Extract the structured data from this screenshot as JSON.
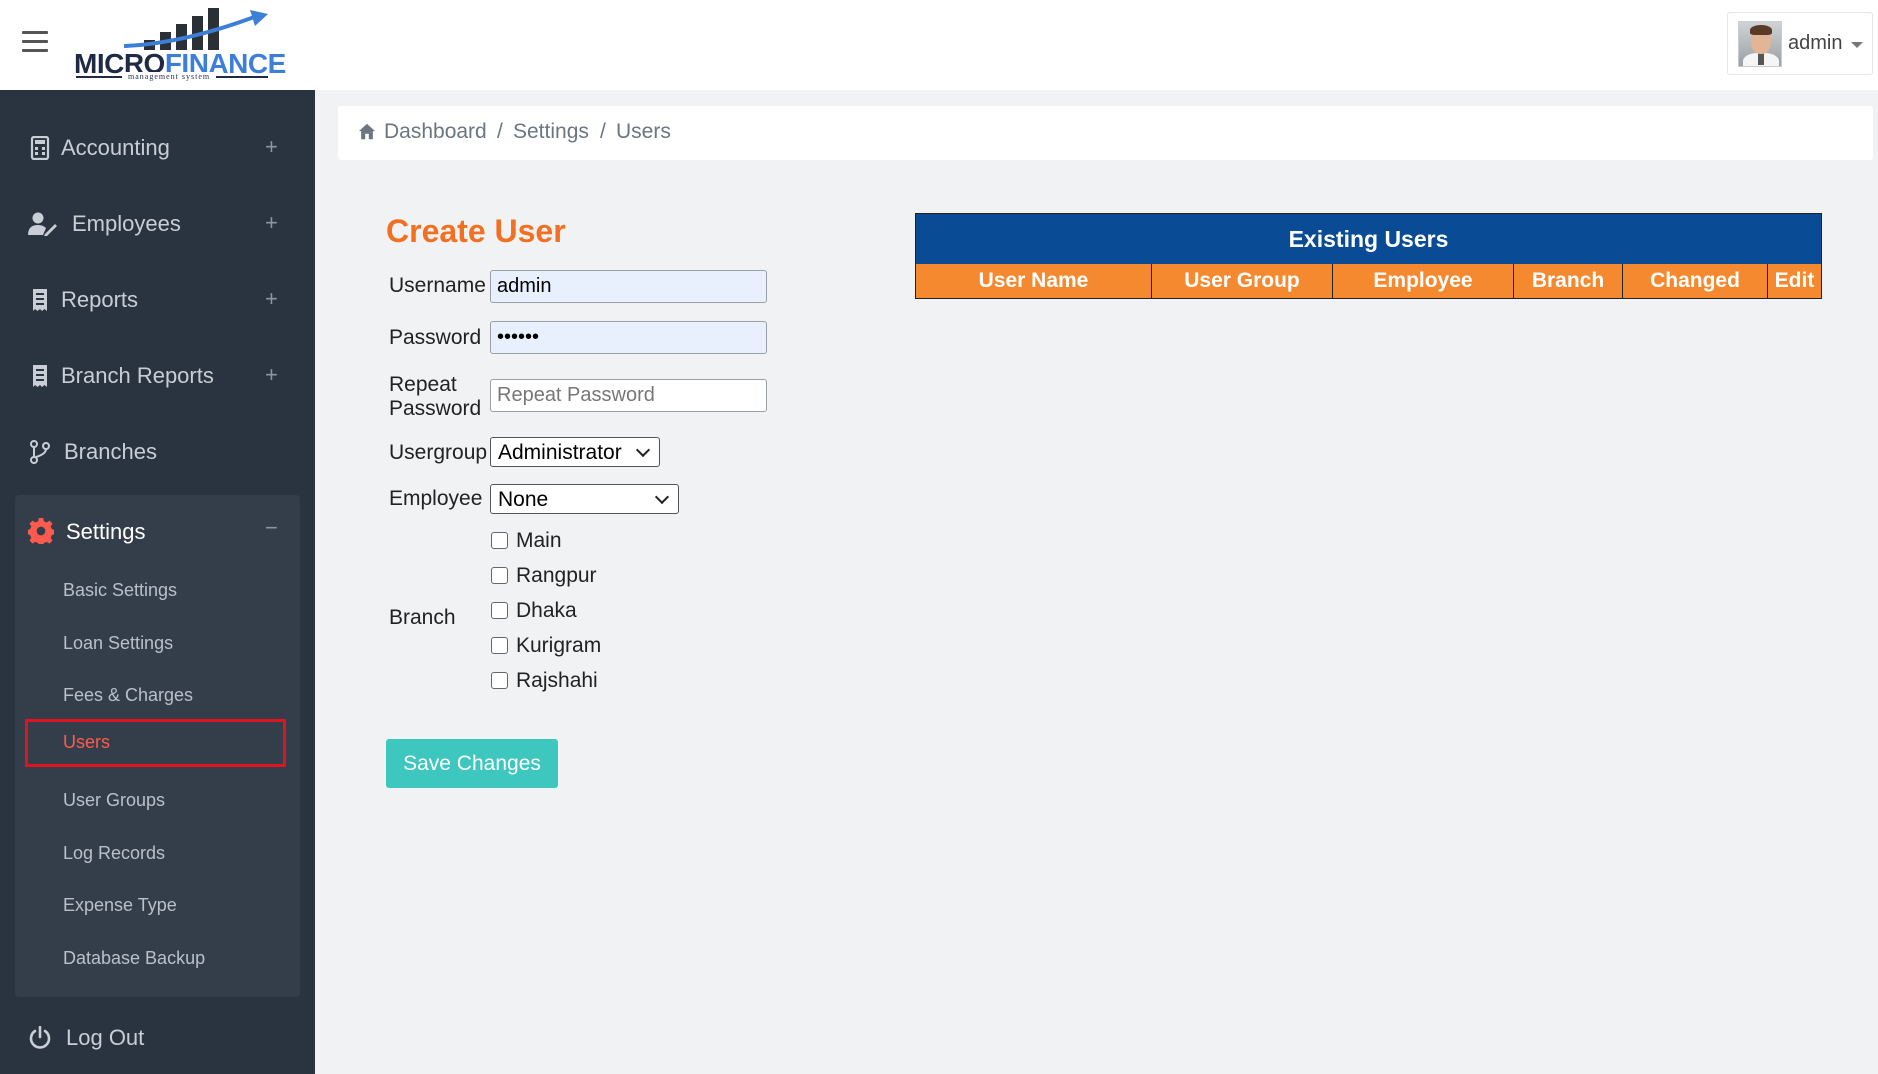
{
  "header": {
    "logo": {
      "brand_part1": "MICRO",
      "brand_part2": "FINANCE",
      "tagline": "management system"
    },
    "user": {
      "name": "admin"
    }
  },
  "sidebar": {
    "items": [
      {
        "label": "Accounting",
        "icon": "calculator-icon",
        "expand": "+"
      },
      {
        "label": "Employees",
        "icon": "user-edit-icon",
        "expand": "+"
      },
      {
        "label": "Reports",
        "icon": "receipt-icon",
        "expand": "+"
      },
      {
        "label": "Branch Reports",
        "icon": "receipt-icon",
        "expand": "+"
      },
      {
        "label": "Branches",
        "icon": "branch-icon"
      }
    ],
    "settings": {
      "label": "Settings",
      "icon": "gear-icon",
      "collapse": "−",
      "subitems": [
        {
          "label": "Basic Settings"
        },
        {
          "label": "Loan Settings"
        },
        {
          "label": "Fees & Charges"
        },
        {
          "label": "Users",
          "active": true
        },
        {
          "label": "User Groups"
        },
        {
          "label": "Log Records"
        },
        {
          "label": "Expense Type"
        },
        {
          "label": "Database Backup"
        }
      ]
    },
    "logout": {
      "label": "Log Out",
      "icon": "power-icon"
    }
  },
  "breadcrumb": {
    "items": [
      "Dashboard",
      "Settings",
      "Users"
    ],
    "separator": "/"
  },
  "form": {
    "title": "Create User",
    "username": {
      "label": "Username",
      "value": "admin"
    },
    "password": {
      "label": "Password",
      "value": "••••••"
    },
    "repeat_password": {
      "label_line1": "Repeat",
      "label_line2": "Password",
      "placeholder": "Repeat Password"
    },
    "usergroup": {
      "label": "Usergroup",
      "selected": "Administrator"
    },
    "employee": {
      "label": "Employee",
      "selected": "None"
    },
    "branch": {
      "label": "Branch",
      "options": [
        {
          "label": "Main",
          "checked": false
        },
        {
          "label": "Rangpur",
          "checked": false
        },
        {
          "label": "Dhaka",
          "checked": false
        },
        {
          "label": "Kurigram",
          "checked": false
        },
        {
          "label": "Rajshahi",
          "checked": false
        }
      ]
    },
    "save_label": "Save Changes"
  },
  "existing_users": {
    "title": "Existing Users",
    "columns": [
      "User Name",
      "User Group",
      "Employee",
      "Branch",
      "Changed",
      "Edit"
    ],
    "rows": []
  },
  "colors": {
    "sidebar_bg": "#2a3440",
    "accent_orange": "#f36f21",
    "table_title_bg": "#0a4b95",
    "table_header_bg": "#f5892f",
    "save_button_bg": "#3ec7be",
    "active_border": "#e0141e"
  }
}
